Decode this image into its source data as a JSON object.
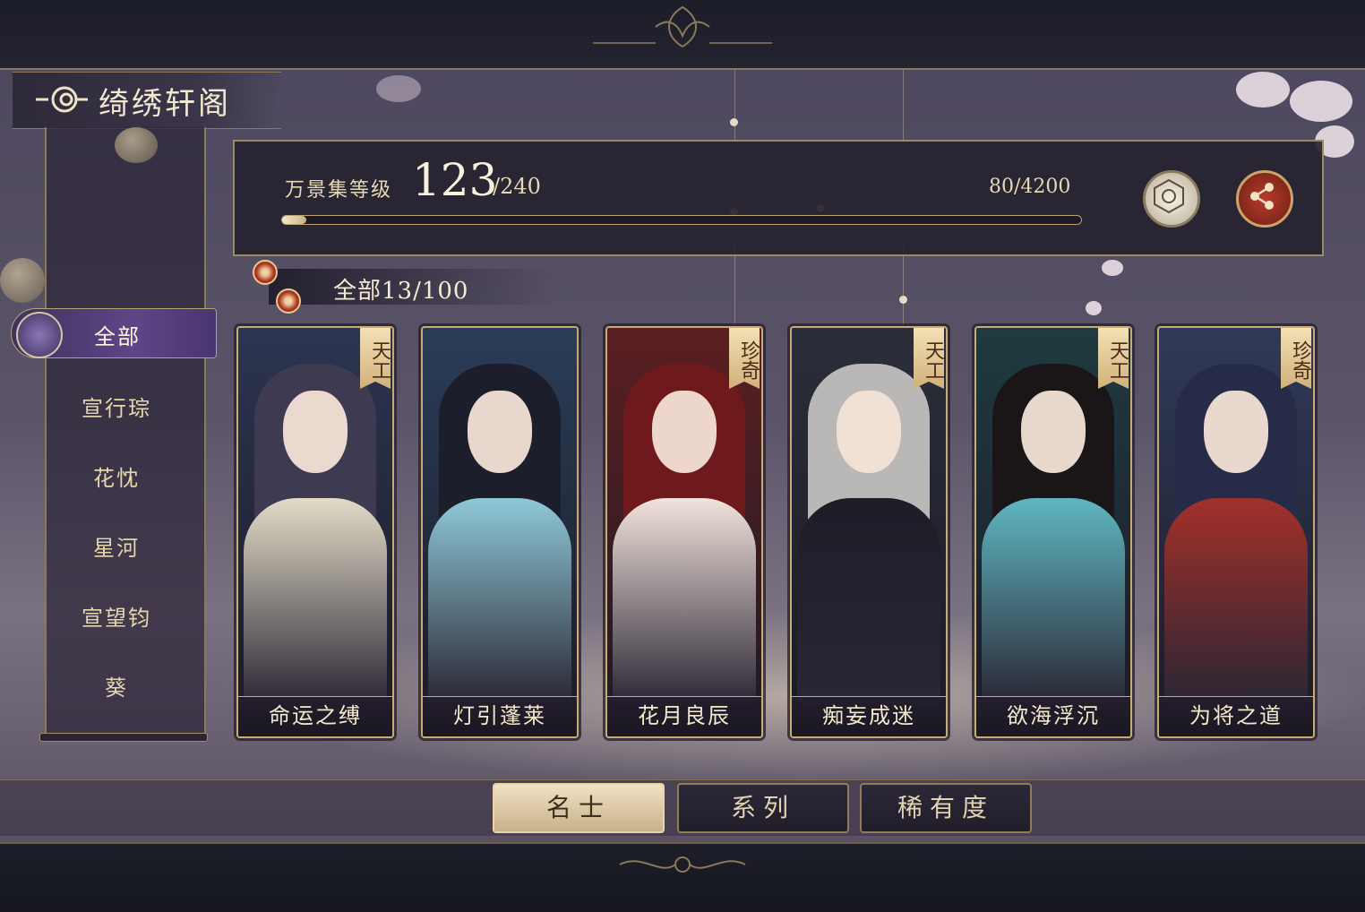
{
  "title": "绮绣轩阁",
  "level": {
    "label": "万景集等级",
    "current": "123",
    "max": "/240",
    "exp_text": "80/4200",
    "exp_progress": 0.019
  },
  "count_label": "全部13/100",
  "sidebar": {
    "items": [
      {
        "label": "全部",
        "active": true
      },
      {
        "label": "宣行琮",
        "active": false
      },
      {
        "label": "花忱",
        "active": false
      },
      {
        "label": "星河",
        "active": false
      },
      {
        "label": "宣望钧",
        "active": false
      },
      {
        "label": "葵",
        "active": false
      }
    ]
  },
  "cards": [
    {
      "name": "命运之缚",
      "rarity": "天工",
      "palette": {
        "bg": "#2c3550",
        "hair": "#3e3a52",
        "robe": "#e3dcc8"
      }
    },
    {
      "name": "灯引蓬莱",
      "rarity": "",
      "palette": {
        "bg": "#2a3d58",
        "hair": "#1c1e2c",
        "robe": "#8fc8d8"
      }
    },
    {
      "name": "花月良辰",
      "rarity": "珍奇",
      "palette": {
        "bg": "#5c1f22",
        "hair": "#6e1a1c",
        "robe": "#f2e3dc"
      }
    },
    {
      "name": "痴妄成迷",
      "rarity": "天工",
      "palette": {
        "bg": "#2b2e3a",
        "hair": "#b9b8b6",
        "robe": "#1d1d28"
      }
    },
    {
      "name": "欲海浮沉",
      "rarity": "天工",
      "palette": {
        "bg": "#1f3a40",
        "hair": "#1a1618",
        "robe": "#5fb7c2"
      }
    },
    {
      "name": "为将之道",
      "rarity": "珍奇",
      "palette": {
        "bg": "#303a58",
        "hair": "#262c48",
        "robe": "#a3302a"
      }
    }
  ],
  "tabs": [
    {
      "label": "名士",
      "active": true
    },
    {
      "label": "系列",
      "active": false
    },
    {
      "label": "稀有度",
      "active": false
    }
  ],
  "icons": {
    "title": "cloud-swirl-icon",
    "collection_button": "collection-icon",
    "share_button": "share-icon",
    "flower": "plum-blossom-icon"
  }
}
